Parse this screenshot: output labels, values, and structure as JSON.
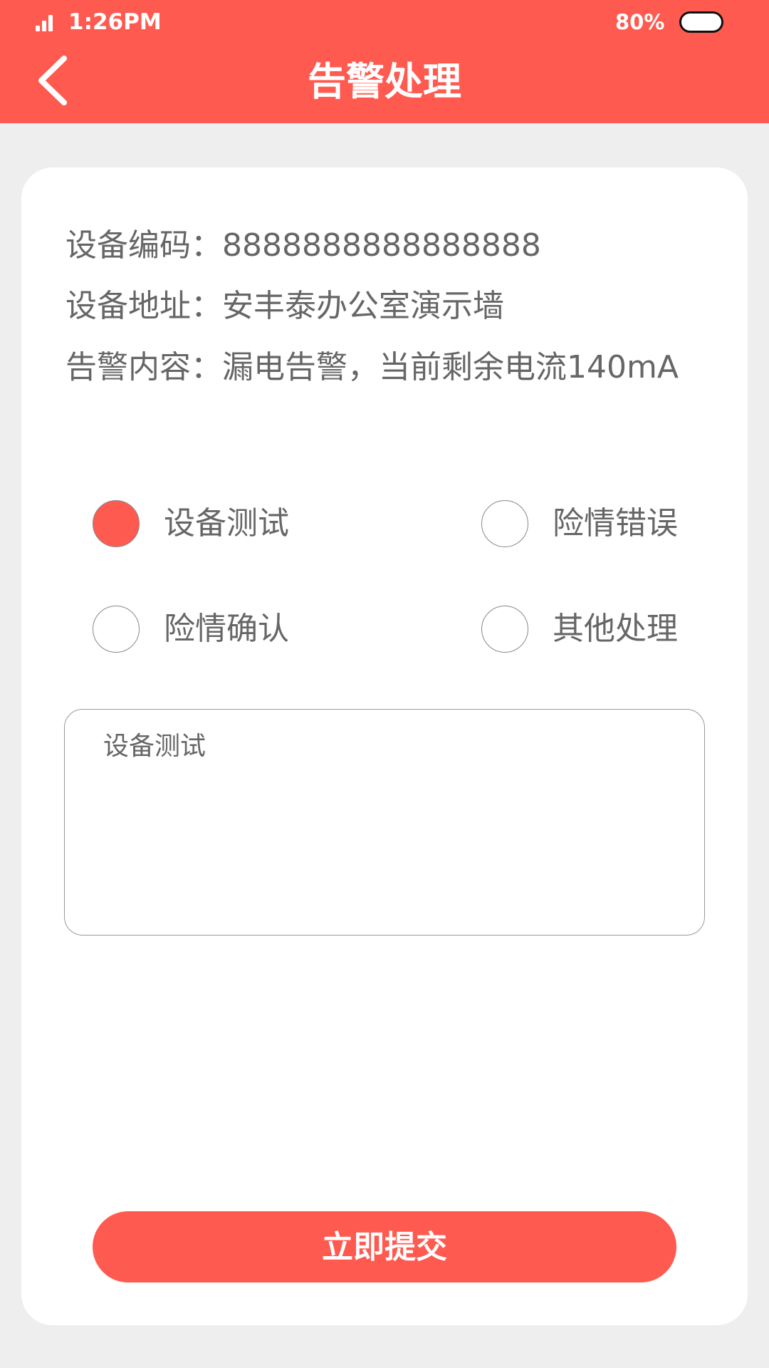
{
  "status_bar": {
    "time": "1:26PM",
    "battery_percent": "80%"
  },
  "header": {
    "title": "告警处理",
    "back_icon": "chevron-left-icon"
  },
  "device_info": {
    "code_label": "设备编码：",
    "code_value": "8888888888888888",
    "address_label": "设备地址：",
    "address_value": "安丰泰办公室演示墙",
    "alarm_label": "告警内容：",
    "alarm_value": "漏电告警，当前剩余电流140mA"
  },
  "options": {
    "selected": "设备测试",
    "items": [
      {
        "label": "设备测试",
        "checked": true
      },
      {
        "label": "险情错误",
        "checked": false
      },
      {
        "label": "险情确认",
        "checked": false
      },
      {
        "label": "其他处理",
        "checked": false
      }
    ]
  },
  "remark": {
    "value": "设备测试"
  },
  "submit": {
    "label": "立即提交"
  },
  "colors": {
    "accent": "#ff5a50",
    "text": "#666666",
    "background": "#eeeeee"
  }
}
